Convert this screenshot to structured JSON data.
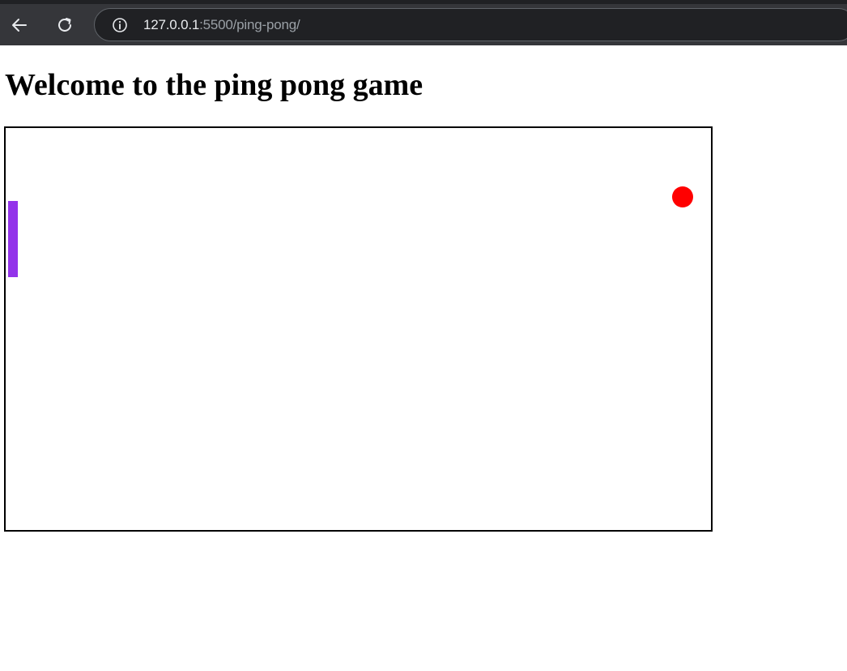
{
  "browser": {
    "back_icon": "arrow-left-icon",
    "reload_icon": "reload-icon",
    "info_icon": "info-icon",
    "url_host": "127.0.0.1",
    "url_rest": ":5500/ping-pong/"
  },
  "page": {
    "title": "Welcome to the ping pong game"
  },
  "game": {
    "paddle_color": "#9333ea",
    "ball_color": "#ff0000",
    "board_border_color": "#000000"
  }
}
